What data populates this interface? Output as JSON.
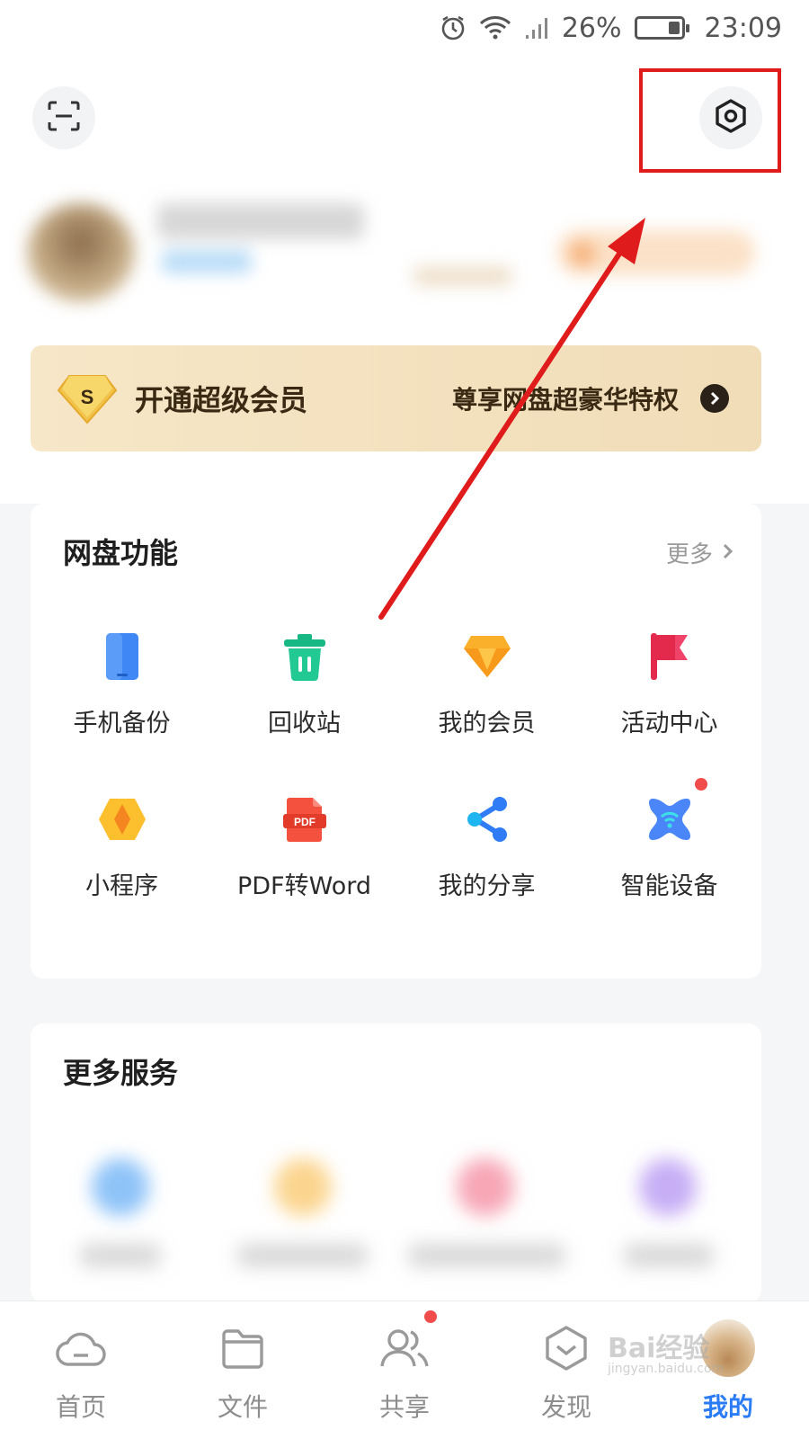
{
  "status_bar": {
    "battery_percent": "26%",
    "battery_level": 0.26,
    "time": "23:09",
    "icons": [
      "alarm-icon",
      "wifi-icon",
      "signal-icon",
      "battery-icon"
    ]
  },
  "header": {
    "scan_icon": "scan-icon",
    "settings_icon": "settings-hexagon-icon"
  },
  "vip_banner": {
    "badge_letter": "S",
    "title": "开通超级会员",
    "subtitle": "尊享网盘超豪华特权"
  },
  "features": {
    "title": "网盘功能",
    "more_label": "更多",
    "items": [
      {
        "label": "手机备份",
        "icon": "phone-backup-icon"
      },
      {
        "label": "回收站",
        "icon": "recycle-bin-icon"
      },
      {
        "label": "我的会员",
        "icon": "member-gem-icon"
      },
      {
        "label": "活动中心",
        "icon": "flag-icon"
      },
      {
        "label": "小程序",
        "icon": "mini-program-icon"
      },
      {
        "label": "PDF转Word",
        "icon": "pdf-icon",
        "icon_text": "PDF"
      },
      {
        "label": "我的分享",
        "icon": "share-icon"
      },
      {
        "label": "智能设备",
        "icon": "smart-device-icon",
        "badge": true
      }
    ]
  },
  "more_services": {
    "title": "更多服务"
  },
  "bottom_nav": {
    "items": [
      {
        "label": "首页",
        "icon": "cloud-icon"
      },
      {
        "label": "文件",
        "icon": "folder-icon"
      },
      {
        "label": "共享",
        "icon": "people-icon",
        "badge": true
      },
      {
        "label": "发现",
        "icon": "discover-icon"
      },
      {
        "label": "我的",
        "icon": "avatar",
        "active": true
      }
    ]
  },
  "watermark": {
    "text": "Bai经验",
    "sub": "jingyan.baidu.com"
  },
  "colors": {
    "accent": "#2a7bf6",
    "annotation_red": "#e01b1b",
    "vip_gold": "#f3e0bd",
    "badge_red": "#f04c4c"
  }
}
